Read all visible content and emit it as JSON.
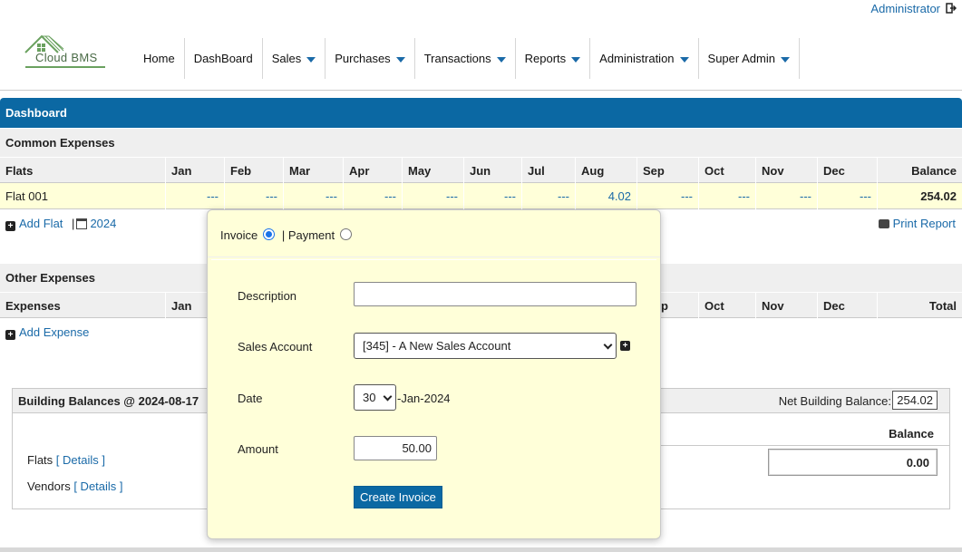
{
  "header": {
    "user_link": "Administrator",
    "logo_text": "Cloud BMS",
    "nav": [
      {
        "label": "Home",
        "dropdown": false
      },
      {
        "label": "DashBoard",
        "dropdown": false
      },
      {
        "label": "Sales",
        "dropdown": true
      },
      {
        "label": "Purchases",
        "dropdown": true
      },
      {
        "label": "Transactions",
        "dropdown": true
      },
      {
        "label": "Reports",
        "dropdown": true
      },
      {
        "label": "Administration",
        "dropdown": true
      },
      {
        "label": "Super Admin",
        "dropdown": true
      }
    ]
  },
  "dashboard": {
    "title": "Dashboard",
    "common_expenses": {
      "title": "Common Expenses",
      "columns": [
        "Flats",
        "Jan",
        "Feb",
        "Mar",
        "Apr",
        "May",
        "Jun",
        "Jul",
        "Aug",
        "Sep",
        "Oct",
        "Nov",
        "Dec",
        "Balance"
      ],
      "rows": [
        {
          "name": "Flat 001",
          "months": [
            "---",
            "---",
            "---",
            "---",
            "---",
            "---",
            "---",
            "4.02",
            "---",
            "---",
            "---",
            "---"
          ],
          "balance": "254.02"
        }
      ],
      "add_flat": "Add Flat",
      "year": "2024",
      "print": "Print Report"
    },
    "other_expenses": {
      "title": "Other Expenses",
      "columns": [
        "Expenses",
        "Jan",
        "p",
        "Oct",
        "Nov",
        "Dec",
        "Total"
      ],
      "add_expense": "Add Expense"
    },
    "building_balances": {
      "title": "Building Balances @ 2024-08-17",
      "net_label": "Net Building Balance:",
      "net_value": "254.02",
      "balance_header": "Balance",
      "balance_value": "0.00",
      "flats_label": "Flats",
      "vendors_label": "Vendors",
      "details": "[ Details ]"
    }
  },
  "popup": {
    "invoice_label": "Invoice",
    "payment_label": "| Payment",
    "selected": "invoice",
    "description_label": "Description",
    "description_value": "",
    "sales_account_label": "Sales Account",
    "sales_account_value": "[345] - A New Sales Account",
    "date_label": "Date",
    "date_day": "30",
    "date_suffix": "-Jan-2024",
    "amount_label": "Amount",
    "amount_value": "50.00",
    "create_button": "Create Invoice"
  }
}
